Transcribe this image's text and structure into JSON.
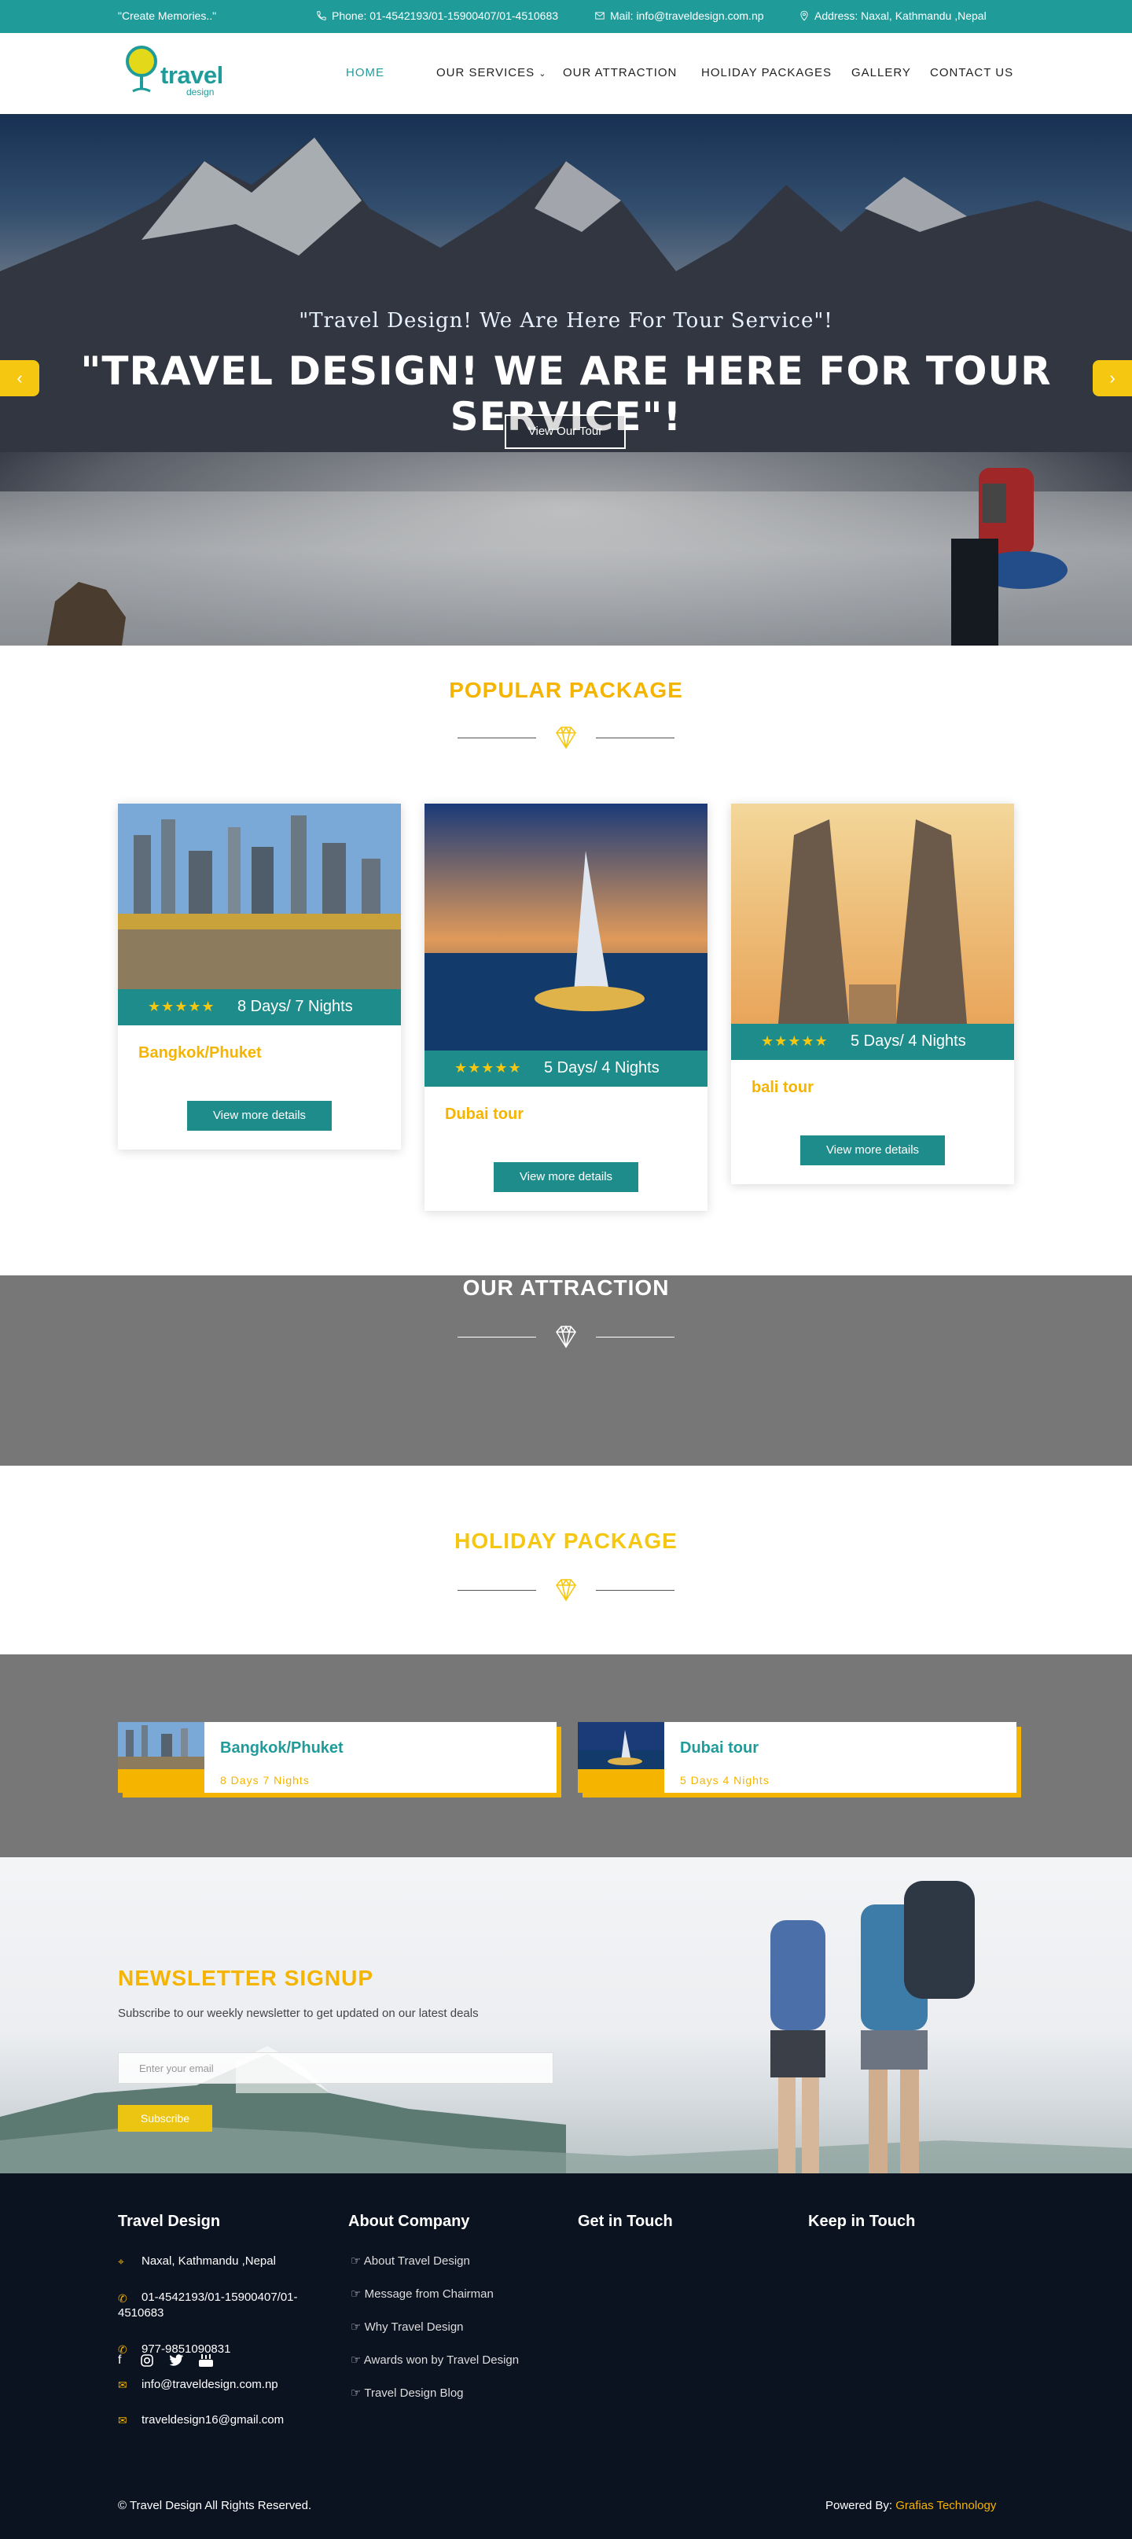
{
  "topbar": {
    "tagline": "\"Create Memories..\"",
    "phone": "Phone: 01-4542193/01-15900407/01-4510683",
    "mail": "Mail: info@traveldesign.com.np",
    "address": "Address: Naxal, Kathmandu ,Nepal"
  },
  "header": {
    "logo_text": "travel",
    "logo_sub": "design",
    "nav": [
      "HOME",
      "OUR SERVICES",
      "OUR ATTRACTION",
      "HOLIDAY PACKAGES",
      "GALLERY",
      "CONTACT US"
    ]
  },
  "hero": {
    "subtitle": "\"Travel Design! We Are Here For Tour Service\"!",
    "title": "\"TRAVEL DESIGN! WE ARE HERE FOR TOUR SERVICE\"!",
    "button": "View Our Tour",
    "prev_icon": "chevron-left-icon",
    "next_icon": "chevron-right-icon"
  },
  "popular": {
    "title": "POPULAR PACKAGE",
    "packages": [
      {
        "duration": "8 Days/ 7  Nights",
        "name": "Bangkok/Phuket",
        "button": "View more details",
        "stars": "★★★★★"
      },
      {
        "duration": "5 Days/ 4  Nights",
        "name": "Dubai tour",
        "button": "View more details",
        "stars": "★★★★★"
      },
      {
        "duration": "5 Days/ 4  Nights",
        "name": "bali tour",
        "button": "View more details",
        "stars": "★★★★★"
      }
    ]
  },
  "attraction": {
    "title": "OUR ATTRACTION"
  },
  "holiday": {
    "title": "HOLIDAY PACKAGE",
    "cards": [
      {
        "name": "Bangkok/Phuket",
        "duration": "8  Days   7  Nights"
      },
      {
        "name": "Dubai tour",
        "duration": "5  Days   4  Nights"
      }
    ]
  },
  "newsletter": {
    "title": "NEWSLETTER SIGNUP",
    "desc": "Subscribe to our weekly newsletter to get updated on our latest deals",
    "placeholder": "Enter your email",
    "button": "Subscribe"
  },
  "footer": {
    "col1_title": "Travel Design",
    "col2_title": "About Company",
    "col3_title": "Get in Touch",
    "col4_title": "Keep in Touch",
    "address": "Naxal, Kathmandu ,Nepal",
    "phone_line1": "01-4542193/01-15900407/01-",
    "phone_line2": "4510683",
    "mobile": "977-9851090831",
    "email1": "info@traveldesign.com.np",
    "email2": "traveldesign16@gmail.com",
    "links": [
      "About Travel Design",
      "Message from Chairman",
      "Why Travel Design",
      "Awards won by Travel Design",
      "Travel Design Blog"
    ],
    "copyright": "© Travel Design All Rights Reserved.",
    "powered_label": "Powered By:",
    "powered_brand": "Grafias Technology"
  },
  "colors": {
    "teal": "#1f9c9a",
    "gold": "#f5b400",
    "yellow": "#f5c710",
    "gray_section": "#777777",
    "footer_bg": "#0b1220"
  }
}
